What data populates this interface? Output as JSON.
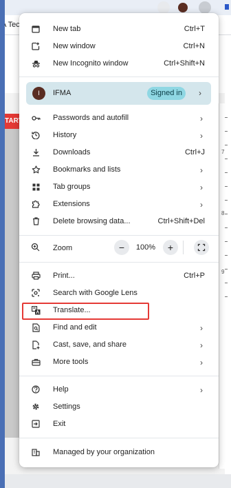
{
  "background": {
    "tab_text": "A Tec",
    "start_badge": "TART",
    "ruler_numbers": [
      "7",
      "8",
      "9"
    ]
  },
  "menu": {
    "group1": [
      {
        "label": "New tab",
        "shortcut": "Ctrl+T",
        "icon": "new-tab-icon"
      },
      {
        "label": "New window",
        "shortcut": "Ctrl+N",
        "icon": "new-window-icon"
      },
      {
        "label": "New Incognito window",
        "shortcut": "Ctrl+Shift+N",
        "icon": "incognito-icon"
      }
    ],
    "profile": {
      "avatar_letter": "I",
      "name": "IFMA",
      "badge": "Signed in"
    },
    "group2": [
      {
        "label": "Passwords and autofill",
        "icon": "key-icon"
      },
      {
        "label": "History",
        "icon": "history-icon"
      },
      {
        "label": "Downloads",
        "shortcut": "Ctrl+J",
        "icon": "download-icon"
      },
      {
        "label": "Bookmarks and lists",
        "icon": "star-icon"
      },
      {
        "label": "Tab groups",
        "icon": "tab-groups-icon"
      },
      {
        "label": "Extensions",
        "icon": "puzzle-icon"
      },
      {
        "label": "Delete browsing data...",
        "shortcut": "Ctrl+Shift+Del",
        "icon": "trash-icon"
      }
    ],
    "zoom": {
      "label": "Zoom",
      "minus": "−",
      "value": "100%",
      "plus": "+"
    },
    "group3": [
      {
        "label": "Print...",
        "shortcut": "Ctrl+P",
        "icon": "printer-icon"
      },
      {
        "label": "Search with Google Lens",
        "icon": "lens-icon"
      },
      {
        "label": "Translate...",
        "icon": "translate-icon"
      },
      {
        "label": "Find and edit",
        "icon": "find-icon"
      },
      {
        "label": "Cast, save, and share",
        "icon": "cast-icon"
      },
      {
        "label": "More tools",
        "icon": "toolbox-icon"
      }
    ],
    "group4": [
      {
        "label": "Help",
        "icon": "help-icon"
      },
      {
        "label": "Settings",
        "icon": "gear-icon"
      },
      {
        "label": "Exit",
        "icon": "exit-icon"
      }
    ],
    "managed": {
      "label": "Managed by your organization",
      "icon": "building-icon"
    }
  },
  "colors": {
    "highlight": "#e53935",
    "profile_bg": "#d4e6ec",
    "badge_bg": "#8fd7e3"
  }
}
